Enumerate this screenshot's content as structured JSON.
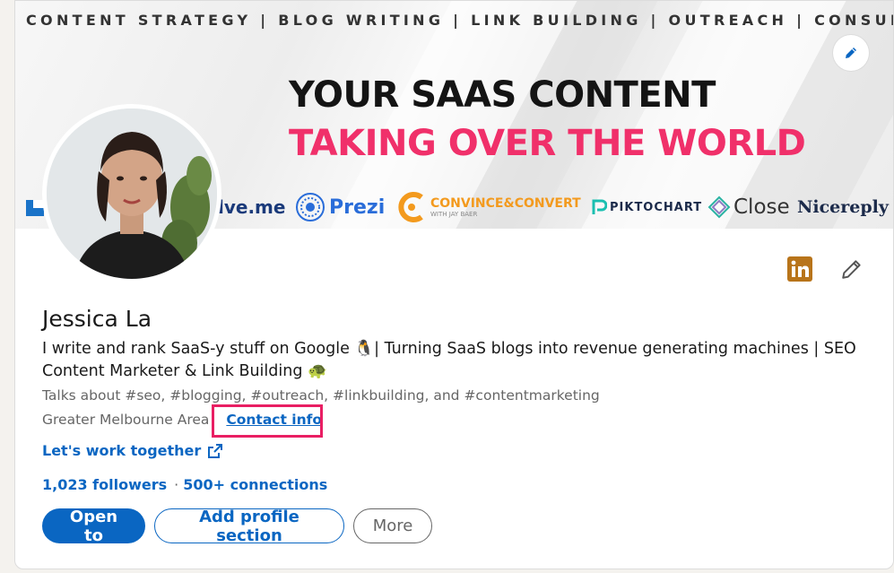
{
  "banner": {
    "tagline": "CONTENT STRATEGY | BLOG WRITING | LINK BUILDING | OUTREACH | CONSULTING",
    "headline_line1": "YOUR SAAS CONTENT",
    "headline_line2": "TAKING OVER THE WORLD",
    "logos": [
      {
        "name": "lve.me",
        "color": "#1a3a7a"
      },
      {
        "name": "Prezi",
        "color": "#2a6dd9"
      },
      {
        "name": "CONVINCE&CONVERT",
        "sub": "WITH JAY BAER",
        "color": "#f39a1e"
      },
      {
        "name": "PIKTOCHART",
        "color": "#1b2a4a"
      },
      {
        "name": "Close",
        "color": "#333333"
      },
      {
        "name": "Nicereply",
        "color": "#1b2a4a"
      }
    ]
  },
  "profile": {
    "name": "Jessica La",
    "headline": "I write and rank SaaS-y stuff on Google 🐧| Turning SaaS blogs into revenue generating machines | SEO Content Marketer & Link Building 🐢",
    "talks_about": "Talks about #seo, #blogging, #outreach, #linkbuilding, and #contentmarketing",
    "location": "Greater Melbourne Area",
    "location_sep": "·",
    "contact_info": "Contact info",
    "website_label": "Let's work together",
    "followers": "1,023 followers",
    "stats_sep": "·",
    "connections": "500+ connections"
  },
  "actions": {
    "open_to": "Open to",
    "add_section": "Add profile section",
    "more": "More"
  },
  "colors": {
    "accent": "#0a66c2",
    "highlight_box": "#e91e63",
    "headline_pink": "#f0306a",
    "linkedin_badge": "#b8741a"
  },
  "icons": [
    "edit-pencil-icon",
    "linkedin-badge-icon",
    "pencil-icon",
    "external-link-icon"
  ]
}
